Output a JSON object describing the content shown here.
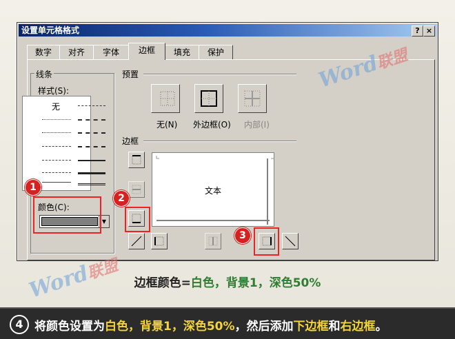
{
  "dialog": {
    "title": "设置单元格格式",
    "help_btn": "?",
    "close_btn": "×",
    "tabs": [
      "数字",
      "对齐",
      "字体",
      "边框",
      "填充",
      "保护"
    ],
    "active_tab": "边框"
  },
  "line_group": {
    "title": "线条",
    "style_label": "样式(S):",
    "none_label": "无",
    "color_label": "颜色(C):",
    "color_value": "#808080"
  },
  "presets": {
    "title": "预置",
    "items": [
      {
        "label": "无(N)",
        "icon": "no-border-icon",
        "enabled": true
      },
      {
        "label": "外边框(O)",
        "icon": "outline-border-icon",
        "enabled": true
      },
      {
        "label": "内部(I)",
        "icon": "inside-border-icon",
        "enabled": false
      }
    ]
  },
  "border": {
    "title": "边框",
    "preview_text": "文本"
  },
  "callouts": [
    "1",
    "2",
    "3"
  ],
  "watermark": {
    "brand": "Word",
    "sub": "联盟"
  },
  "caption": {
    "prefix": "边框颜色=",
    "highlight": "白色，背景1，深色50%"
  },
  "footer": {
    "step": "4",
    "parts": [
      "将颜色设置为",
      "白色，背景1，深色50%",
      "，然后添加",
      "下边框",
      "和",
      "右边框",
      "。"
    ]
  }
}
